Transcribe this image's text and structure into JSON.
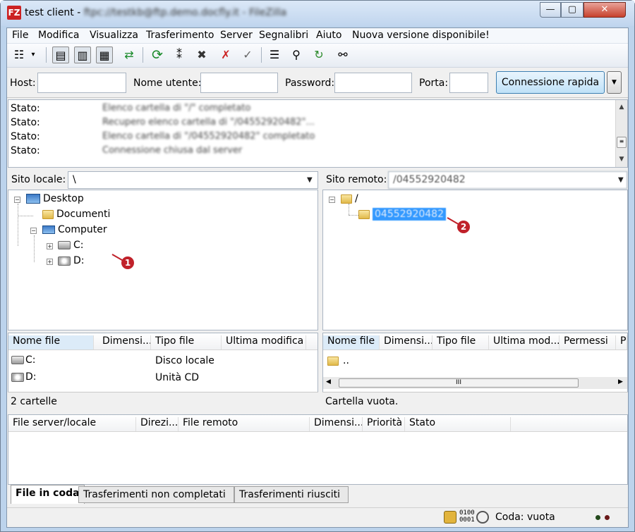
{
  "window": {
    "title_prefix": "test client -",
    "title_blurred": "ftpc://testkb@ftp.demo.docfly.it - FileZilla",
    "min_glyph": "—",
    "max_glyph": "▢",
    "close_glyph": "✕",
    "app_icon_glyph": "FZ"
  },
  "menu": [
    "File",
    "Modifica",
    "Visualizza",
    "Trasferimento",
    "Server",
    "Segnalibri",
    "Aiuto",
    "Nuova versione disponibile!"
  ],
  "toolbar": {
    "icons": [
      "site-manager-icon",
      "processing-queue-icon",
      "toggle-log-icon",
      "toggle-local-tree-icon",
      "toggle-remote-tree-icon",
      "synchronize-icon",
      "refresh-icon",
      "process-queue-icon",
      "cancel-icon",
      "disconnect-icon",
      "reconnect-icon",
      "directory-compare-icon",
      "filter-icon",
      "sync-browsing-icon",
      "search-icon"
    ],
    "glyphs": [
      "☷",
      "▾",
      "▤",
      "▥",
      "▦",
      "⇄",
      "⟳",
      "⁑",
      "✖",
      "✗",
      "✓",
      "☰",
      "⚲",
      "↻",
      "⚯"
    ]
  },
  "quickconnect": {
    "host_label": "Host:",
    "user_label": "Nome utente:",
    "pass_label": "Password:",
    "port_label": "Porta:",
    "host_value": "",
    "user_value": "",
    "pass_value": "",
    "port_value": "",
    "connect_label": "Connessione rapida",
    "dropdown_glyph": "▼"
  },
  "log": {
    "rows": [
      {
        "label": "Stato:",
        "message": "Elenco cartella di \"/\" completato"
      },
      {
        "label": "Stato:",
        "message": "Recupero elenco cartella di \"/04552920482\"..."
      },
      {
        "label": "Stato:",
        "message": "Elenco cartella di \"/04552920482\" completato"
      },
      {
        "label": "Stato:",
        "message": "Connessione chiusa dal server"
      }
    ],
    "up_glyph": "▲",
    "down_glyph": "▼",
    "thumb_glyph": "≡"
  },
  "local": {
    "site_label": "Sito locale:",
    "site_value": "\\",
    "dd_glyph": "▼",
    "tree": {
      "desktop": "Desktop",
      "documenti": "Documenti",
      "computer": "Computer",
      "c": "C:",
      "d": "D:"
    },
    "headers": [
      "Nome file",
      "Dimensi...",
      "Tipo file",
      "Ultima modifica"
    ],
    "rows": [
      {
        "name": "C:",
        "type": "Disco locale"
      },
      {
        "name": "D:",
        "type": "Unità CD"
      }
    ],
    "status": "2 cartelle"
  },
  "remote": {
    "site_label": "Sito remoto:",
    "site_value": "/04552920482",
    "dd_glyph": "▼",
    "tree": {
      "root": "/",
      "folder": "04552920482"
    },
    "headers": [
      "Nome file",
      "Dimensi...",
      "Tipo file",
      "Ultima mod...",
      "Permessi",
      "Pr"
    ],
    "rows": [
      {
        "name": ".."
      }
    ],
    "status": "Cartella vuota.",
    "scroll_left": "◀",
    "scroll_right": "▶",
    "scroll_thumb": "III"
  },
  "queue": {
    "headers": [
      "File server/locale",
      "Direzi...",
      "File remoto",
      "Dimensi...",
      "Priorità",
      "Stato"
    ],
    "tabs": [
      "File in coda",
      "Trasferimenti non completati",
      "Trasferimenti riusciti"
    ]
  },
  "statusbar": {
    "bits_glyph": "0100\n0001",
    "queue_text": "Coda: vuota"
  },
  "callouts": [
    "1",
    "2"
  ],
  "colors": {
    "accent": "#3399ff",
    "callout": "#c0212a",
    "selection": "#3399ff"
  }
}
